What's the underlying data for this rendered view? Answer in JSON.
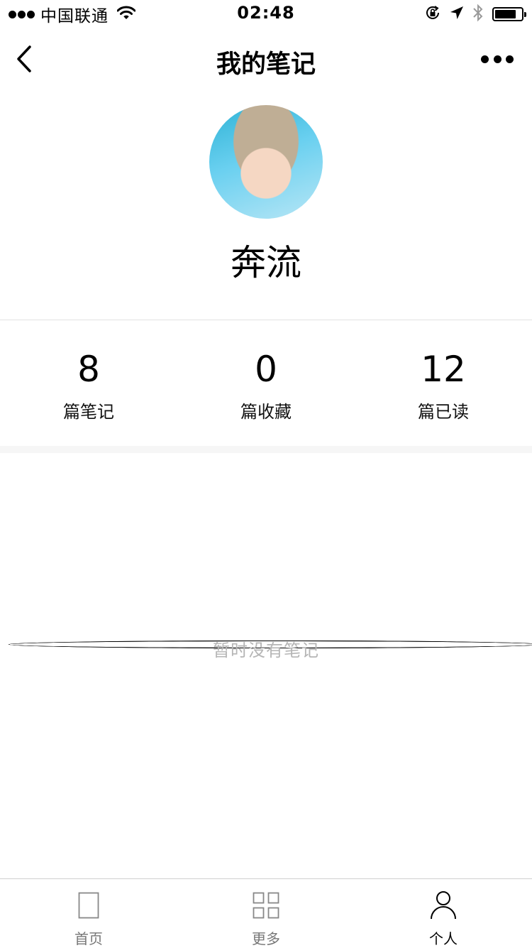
{
  "status_bar": {
    "carrier": "中国联通",
    "time": "02:48",
    "signal_bars_filled": 3,
    "signal_bars_total": 5,
    "icons": [
      "wifi-icon",
      "orientation-lock-icon",
      "location-arrow-icon",
      "bluetooth-icon",
      "battery-icon"
    ],
    "battery_level": 0.8
  },
  "navbar": {
    "title": "我的笔记",
    "back_icon": "chevron-left-icon",
    "more_icon": "more-dots-icon"
  },
  "profile": {
    "name": "奔流"
  },
  "stats": [
    {
      "value": "8",
      "label": "篇笔记"
    },
    {
      "value": "0",
      "label": "篇收藏"
    },
    {
      "value": "12",
      "label": "篇已读"
    }
  ],
  "empty_state": "暂时没有笔记",
  "tabbar": {
    "tabs": [
      {
        "label": "首页",
        "icon": "home-page-icon",
        "active": false
      },
      {
        "label": "更多",
        "icon": "grid-icon",
        "active": false
      },
      {
        "label": "个人",
        "icon": "person-icon",
        "active": true
      }
    ]
  },
  "colors": {
    "text_primary": "#000000",
    "text_muted": "#b5b5b5",
    "tab_inactive": "#777777",
    "divider": "#e2e2e2"
  }
}
